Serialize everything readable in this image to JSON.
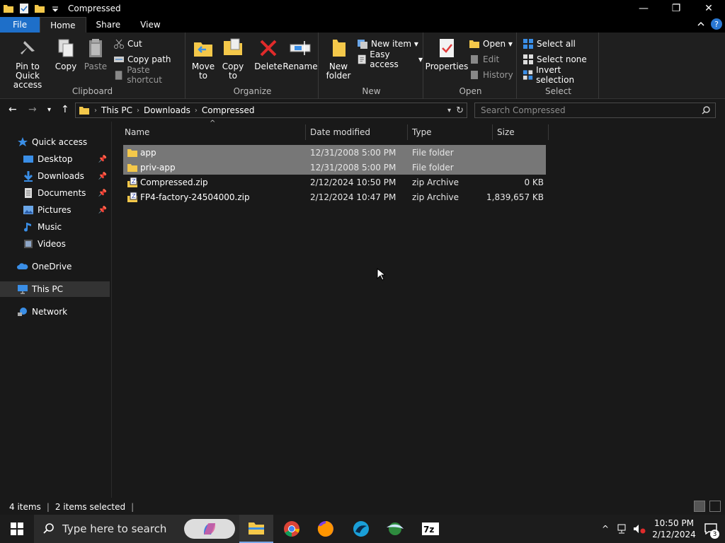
{
  "window": {
    "title": "Compressed",
    "controls": {
      "minimize": "—",
      "maximize": "❐",
      "close": "✕"
    }
  },
  "ribbon_tabs": [
    "File",
    "Home",
    "Share",
    "View"
  ],
  "ribbon": {
    "clipboard": {
      "label": "Clipboard",
      "pin": "Pin to Quick access",
      "copy": "Copy",
      "paste": "Paste",
      "cut": "Cut",
      "copy_path": "Copy path",
      "paste_shortcut": "Paste shortcut"
    },
    "organize": {
      "label": "Organize",
      "move_to": "Move to",
      "copy_to": "Copy to",
      "delete": "Delete",
      "rename": "Rename"
    },
    "new": {
      "label": "New",
      "new_folder": "New folder",
      "new_item": "New item",
      "easy_access": "Easy access"
    },
    "open": {
      "label": "Open",
      "properties": "Properties",
      "open": "Open",
      "edit": "Edit",
      "history": "History"
    },
    "select": {
      "label": "Select",
      "select_all": "Select all",
      "select_none": "Select none",
      "invert": "Invert selection"
    }
  },
  "address": {
    "crumbs": [
      "This PC",
      "Downloads",
      "Compressed"
    ],
    "search_placeholder": "Search Compressed"
  },
  "nav": {
    "quick_access": "Quick access",
    "items": [
      "Desktop",
      "Downloads",
      "Documents",
      "Pictures",
      "Music",
      "Videos"
    ],
    "onedrive": "OneDrive",
    "this_pc": "This PC",
    "network": "Network"
  },
  "columns": {
    "name": "Name",
    "date": "Date modified",
    "type": "Type",
    "size": "Size"
  },
  "files": [
    {
      "name": "app",
      "date": "12/31/2008 5:00 PM",
      "type": "File folder",
      "size": ""
    },
    {
      "name": "priv-app",
      "date": "12/31/2008 5:00 PM",
      "type": "File folder",
      "size": ""
    },
    {
      "name": "Compressed.zip",
      "date": "2/12/2024 10:50 PM",
      "type": "zip Archive",
      "size": "0 KB"
    },
    {
      "name": "FP4-factory-24504000.zip",
      "date": "2/12/2024 10:47 PM",
      "type": "zip Archive",
      "size": "1,839,657 KB"
    }
  ],
  "status": {
    "count": "4 items",
    "selected": "2 items selected"
  },
  "taskbar": {
    "search_placeholder": "Type here to search",
    "time": "10:50 PM",
    "date": "2/12/2024",
    "notif_count": "3"
  },
  "colors": {
    "folder": "#f4c84a",
    "accent": "#1e6fc9",
    "selection": "#777777"
  }
}
